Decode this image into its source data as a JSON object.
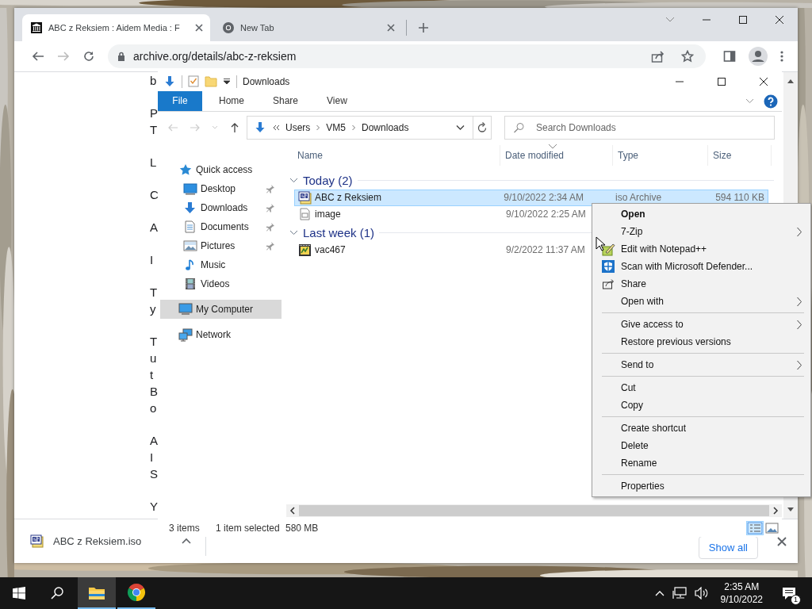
{
  "browser": {
    "tabs": [
      {
        "title": "ABC z Reksiem : Aidem Media : F",
        "selected": true
      },
      {
        "title": "New Tab",
        "selected": false
      }
    ],
    "address": "archive.org/details/abc-z-reksiem",
    "page_fragments": [
      [
        "b"
      ],
      [
        "P",
        "T"
      ],
      [
        "L"
      ],
      [
        "C"
      ],
      [
        "A"
      ],
      [
        "I"
      ],
      [
        "T",
        "y"
      ],
      [
        "T",
        "u",
        "t",
        "B",
        "o"
      ],
      [
        "A",
        "I",
        "S"
      ],
      [
        "Y"
      ]
    ],
    "download_shelf": {
      "file": "ABC z Reksiem.iso",
      "button": "Show all"
    }
  },
  "explorer": {
    "title": "Downloads",
    "ribbon_tabs": [
      {
        "label": "File",
        "selected": true
      },
      {
        "label": "Home",
        "selected": false
      },
      {
        "label": "Share",
        "selected": false
      },
      {
        "label": "View",
        "selected": false
      }
    ],
    "breadcrumb": [
      "Users",
      "VM5",
      "Downloads"
    ],
    "search": {
      "placeholder": "Search Downloads"
    },
    "navigation": [
      {
        "label": "Quick access",
        "selected": false,
        "children": [
          {
            "label": "Desktop",
            "pinned": true,
            "selected": false
          },
          {
            "label": "Downloads",
            "pinned": true,
            "selected": false
          },
          {
            "label": "Documents",
            "pinned": true,
            "selected": false
          },
          {
            "label": "Pictures",
            "pinned": true,
            "selected": false
          },
          {
            "label": "Music",
            "pinned": false,
            "selected": false
          },
          {
            "label": "Videos",
            "pinned": false,
            "selected": false
          }
        ]
      },
      {
        "label": "My Computer",
        "selected": true
      },
      {
        "label": "Network",
        "selected": false
      }
    ],
    "columns": [
      "Name",
      "Date modified",
      "Type",
      "Size"
    ],
    "groups": [
      {
        "label": "Today (2)",
        "expanded": true,
        "files": [
          {
            "name": "ABC z Reksiem",
            "date": "9/10/2022 2:34 AM",
            "type": "iso Archive",
            "size": "594 110 KB",
            "selected": true
          },
          {
            "name": "image",
            "date": "9/10/2022 2:25 AM",
            "selected": false
          }
        ]
      },
      {
        "label": "Last week (1)",
        "expanded": true,
        "files": [
          {
            "name": "vac467",
            "date": "9/2/2022 11:37 AM",
            "selected": false
          }
        ]
      }
    ],
    "status": {
      "count": "3 items",
      "selection": "1 item selected",
      "size": "580 MB"
    },
    "views": [
      {
        "kind": "details",
        "selected": true
      },
      {
        "kind": "large-icons",
        "selected": false
      }
    ]
  },
  "context_menu": {
    "sections": [
      [
        {
          "label": "Open",
          "default": true,
          "submenu": false
        },
        {
          "label": "7-Zip",
          "default": false,
          "submenu": true
        },
        {
          "label": "Edit with Notepad++",
          "default": false,
          "submenu": false
        },
        {
          "label": "Scan with Microsoft Defender...",
          "default": false,
          "submenu": false
        },
        {
          "label": "Share",
          "default": false,
          "submenu": false
        },
        {
          "label": "Open with",
          "default": false,
          "submenu": true
        }
      ],
      [
        {
          "label": "Give access to",
          "default": false,
          "submenu": true
        },
        {
          "label": "Restore previous versions",
          "default": false,
          "submenu": false
        }
      ],
      [
        {
          "label": "Send to",
          "default": false,
          "submenu": true
        }
      ],
      [
        {
          "label": "Cut",
          "default": false,
          "submenu": false
        },
        {
          "label": "Copy",
          "default": false,
          "submenu": false
        }
      ],
      [
        {
          "label": "Create shortcut",
          "default": false,
          "submenu": false
        },
        {
          "label": "Delete",
          "default": false,
          "submenu": false
        },
        {
          "label": "Rename",
          "default": false,
          "submenu": false
        }
      ],
      [
        {
          "label": "Properties",
          "default": false,
          "submenu": false
        }
      ]
    ]
  },
  "taskbar": {
    "apps": [
      {
        "kind": "explorer",
        "active": true
      },
      {
        "kind": "chrome",
        "active": false
      }
    ],
    "time": "2:35 AM",
    "date": "9/10/2022",
    "notifications": "1"
  }
}
